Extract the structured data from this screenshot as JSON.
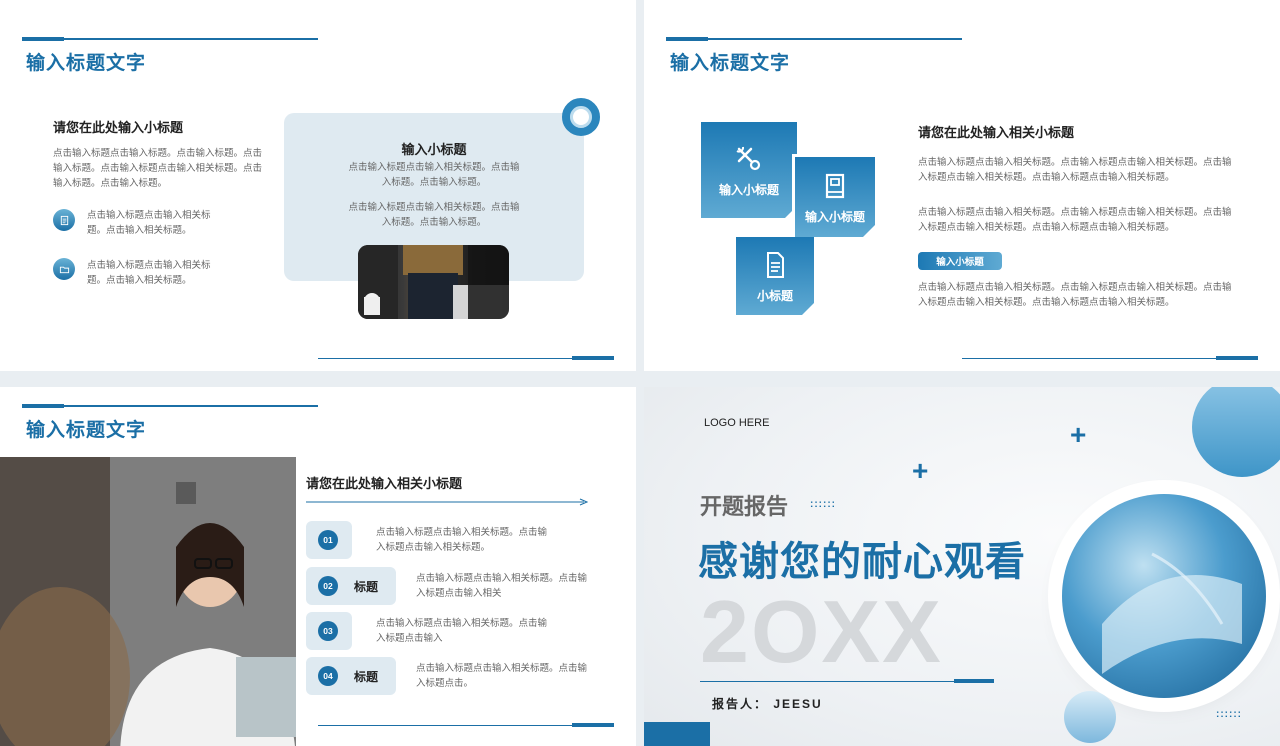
{
  "slide1": {
    "title": "输入标题文字",
    "subtitle": "请您在此处输入小标题",
    "intro": "点击输入标题点击输入标题。点击输入标题。点击输入标题。点击输入标题点击输入相关标题。点击输入标题。点击输入标题。",
    "item1": "点击输入标题点击输入相关标题。点击输入相关标题。",
    "item2": "点击输入标题点击输入相关标题。点击输入相关标题。",
    "card_title": "输入小标题",
    "card_text1": "点击输入标题点击输入相关标题。点击输入标题。点击输入标题。",
    "card_text2": "点击输入标题点击输入相关标题。点击输入标题。点击输入标题。"
  },
  "slide2": {
    "title": "输入标题文字",
    "box1": "输入小标题",
    "box2": "输入小标题",
    "box3": "小标题",
    "subtitle": "请您在此处输入相关小标题",
    "para1": "点击输入标题点击输入相关标题。点击输入标题点击输入相关标题。点击输入标题点击输入相关标题。点击输入标题点击输入相关标题。",
    "para2": "点击输入标题点击输入相关标题。点击输入标题点击输入相关标题。点击输入标题点击输入相关标题。点击输入标题点击输入相关标题。",
    "pill": "输入小标题",
    "para3": "点击输入标题点击输入相关标题。点击输入标题点击输入相关标题。点击输入标题点击输入相关标题。点击输入标题点击输入相关标题。"
  },
  "slide3": {
    "title": "输入标题文字",
    "subtitle": "请您在此处输入相关小标题",
    "items": [
      {
        "num": "01",
        "label": "",
        "text": "点击输入标题点击输入相关标题。点击输入标题点击输入相关标题。"
      },
      {
        "num": "02",
        "label": "标题",
        "text": "点击输入标题点击输入相关标题。点击输入标题点击输入相关"
      },
      {
        "num": "03",
        "label": "",
        "text": "点击输入标题点击输入相关标题。点击输入标题点击输入"
      },
      {
        "num": "04",
        "label": "标题",
        "text": "点击输入标题点击输入相关标题。点击输入标题点击。"
      }
    ]
  },
  "slide4": {
    "logo": "LOGO  HERE",
    "kicker": "开题报告",
    "headline": "感谢您的耐心观看",
    "year": "2OXX",
    "reporter": "报告人：  JEESU"
  },
  "colors": {
    "accent": "#1b6fa6",
    "light": "#dfeaf1"
  }
}
